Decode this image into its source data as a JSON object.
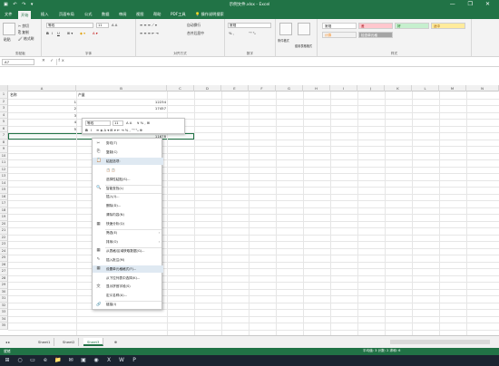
{
  "titlebar": {
    "title": "示例文件.xlsx  -  Excel",
    "qa": "▣ ↶ ↷ ▾",
    "win": "— ❐ ✕"
  },
  "tabs": [
    "文件",
    "开始",
    "插入",
    "页面布局",
    "公式",
    "数据",
    "审阅",
    "视图",
    "帮助",
    "PDF工具",
    "操作说明搜索"
  ],
  "ribbon": {
    "clipboard": {
      "label": "剪贴板",
      "paste": "粘贴",
      "cut": "✂ 剪切",
      "copy": "⎘ 复制",
      "painter": "🖌 格式刷"
    },
    "font": {
      "label": "字体",
      "name": "等线",
      "size": "11",
      "b": "B",
      "i": "I",
      "u": "U"
    },
    "align": {
      "label": "对齐方式",
      "wrap": "自动换行",
      "merge": "合并后居中"
    },
    "number": {
      "label": "数字",
      "fmt": "常规",
      "pct": "% ,",
      "dec": "⁺⁰ ⁰₀"
    },
    "cond": {
      "cf": "条件格式",
      "tbl": "套用表格格式"
    },
    "styles": {
      "label": "样式",
      "normal": "常规",
      "bad": "差",
      "good": "好",
      "neutral": "适中",
      "calc": "计算",
      "check": "检查单元格"
    }
  },
  "formula_bar": {
    "namebox": "A7",
    "fx": "✕ ✓ fx"
  },
  "columns": [
    "A",
    "B",
    "C",
    "D",
    "E",
    "F",
    "G",
    "H",
    "I",
    "J",
    "K",
    "L",
    "M",
    "N"
  ],
  "rows": [
    "1",
    "2",
    "3",
    "4",
    "5",
    "6",
    "7",
    "8",
    "9",
    "10",
    "11",
    "12",
    "13",
    "14",
    "15",
    "16",
    "17",
    "18",
    "19",
    "20",
    "21",
    "22",
    "23",
    "24",
    "25",
    "26",
    "27",
    "28",
    "29",
    "30",
    "31",
    "32",
    "33",
    "34",
    "35"
  ],
  "cells": {
    "a1": "名称",
    "b1": "产量",
    "a2_val": "1",
    "b2": "12234",
    "a3_val": "2",
    "b3": "17457",
    "a4_val": "3",
    "a5_val": "4",
    "a6_val": "5",
    "b7_val": "11678"
  },
  "minibar": {
    "font": "等线",
    "size": "11",
    "b": "B",
    "i": "I",
    "line2": "≡ ◈ A ▾ ⊞ ▾ ⇤ ⇥ % , ⁺⁰ ⁰₀ ⊕"
  },
  "context_menu": [
    {
      "icon": "✂",
      "label": "剪切(T)"
    },
    {
      "icon": "⎘",
      "label": "复制(C)"
    },
    {
      "icon": "📋",
      "label": "粘贴选项:",
      "hl": true
    },
    {
      "icon": "",
      "label": "📋 📋"
    },
    {
      "icon": "",
      "label": "选择性粘贴(S)..."
    },
    {
      "icon": "🔍",
      "label": "智能查找(L)"
    },
    {
      "icon": "",
      "label": "插入(I)..."
    },
    {
      "icon": "",
      "label": "删除(D)..."
    },
    {
      "icon": "",
      "label": "清除内容(N)"
    },
    {
      "icon": "▦",
      "label": "快速分析(Q)"
    },
    {
      "icon": "",
      "label": "筛选(E)",
      "sub": "›"
    },
    {
      "icon": "",
      "label": "排序(O)",
      "sub": "›"
    },
    {
      "icon": "▦",
      "label": "从表格/区域获取数据(G)..."
    },
    {
      "icon": "✎",
      "label": "插入批注(M)"
    },
    {
      "icon": "▦",
      "label": "设置单元格格式(F)...",
      "hl": true
    },
    {
      "icon": "",
      "label": "从下拉列表中选择(K)..."
    },
    {
      "icon": "文",
      "label": "显示拼音字段(S)"
    },
    {
      "icon": "",
      "label": "定义名称(A)..."
    },
    {
      "icon": "🔗",
      "label": "链接(I)"
    }
  ],
  "sheets": [
    "Sheet1",
    "Sheet2",
    "Sheet3"
  ],
  "add_sheet": "⊕",
  "status": {
    "left": "就绪",
    "right": "平均值: 3   计数: 2   求和: 6"
  },
  "taskbar": [
    "⊞",
    "○",
    "▭",
    "e",
    "📁",
    "✉",
    "▣",
    "◉",
    "X",
    "W",
    "P"
  ],
  "colors": {
    "accent": "#217346"
  }
}
